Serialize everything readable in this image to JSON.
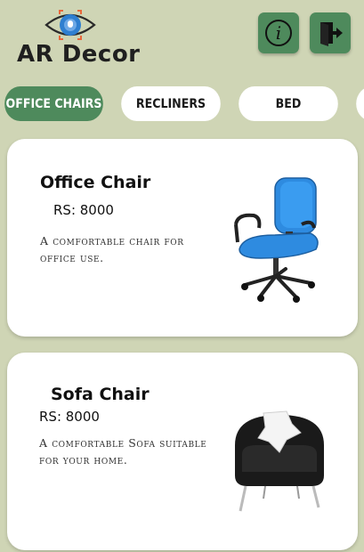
{
  "app": {
    "title": "AR Decor",
    "logo_icon": "eye-scan-icon"
  },
  "header": {
    "info_icon": "info-icon",
    "logout_icon": "logout-icon"
  },
  "tabs": [
    {
      "label": "OFFICE CHAIRS",
      "active": true
    },
    {
      "label": "RECLINERS",
      "active": false
    },
    {
      "label": "BED",
      "active": false
    },
    {
      "label": "",
      "active": false
    }
  ],
  "products": [
    {
      "name": "Office Chair",
      "price": "RS: 8000",
      "description": "A comfortable chair for office use.",
      "image_icon": "office-chair-image"
    },
    {
      "name": "Sofa Chair",
      "price": "RS: 8000",
      "description": "A comfortable Sofa suitable for your home.",
      "image_icon": "sofa-chair-image"
    }
  ],
  "colors": {
    "background": "#cfd5b5",
    "accent": "#4e8a5c",
    "card": "#ffffff",
    "logo_orange": "#e9673a",
    "logo_blue": "#2f7fd0"
  }
}
